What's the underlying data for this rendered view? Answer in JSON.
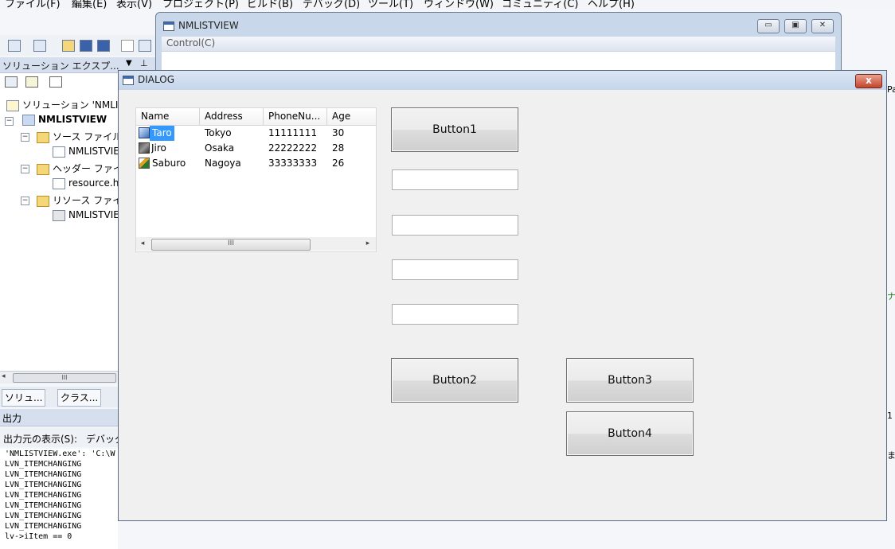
{
  "ide": {
    "menu": [
      "ファイル(F)",
      "編集(E)",
      "表示(V)",
      "プロジェクト(P)",
      "ビルド(B)",
      "デバッグ(D)",
      "ツール(T)",
      "ウィンドウ(W)",
      "コミュニティ(C)",
      "ヘルプ(H)"
    ],
    "solution_explorer_title": "ソリューション エクスプ...",
    "tree": {
      "solution": "ソリューション 'NMLI",
      "project": "NMLISTVIEW",
      "source_folder": "ソース ファイル",
      "source_file": "NMLISTVIE",
      "header_folder": "ヘッダー ファイ",
      "header_file": "resource.h",
      "resource_folder": "リソース ファイ",
      "resource_file": "NMLISTVIE"
    },
    "tabs": [
      "ソリュ...",
      "クラス..."
    ],
    "output_title": "出力",
    "output_source_label": "出力元の表示(S):",
    "output_source_value": "デバッグ",
    "output_lines": [
      "'NMLISTVIEW.exe': 'C:\\W",
      "LVN_ITEMCHANGING",
      "LVN_ITEMCHANGING",
      "LVN_ITEMCHANGING",
      "LVN_ITEMCHANGING",
      "LVN_ITEMCHANGING",
      "LVN_ITEMCHANGING",
      "LVN_ITEMCHANGING",
      "lv->iItem == 0"
    ],
    "right_edge_texts": [
      "Pa",
      "ナ",
      "1",
      "ま"
    ]
  },
  "nmlistview_window": {
    "title": "NMLISTVIEW",
    "menu_control": "Control(C)",
    "minimize": "▭",
    "maximize": "▣",
    "close": "✕"
  },
  "dialog": {
    "title": "DIALOG",
    "close": "x",
    "listview": {
      "columns": [
        "Name",
        "Address",
        "PhoneNu...",
        "Age"
      ],
      "rows": [
        {
          "name": "Taro",
          "address": "Tokyo",
          "phone": "11111111",
          "age": "30",
          "selected": true
        },
        {
          "name": "Jiro",
          "address": "Osaka",
          "phone": "22222222",
          "age": "28",
          "selected": false
        },
        {
          "name": "Saburo",
          "address": "Nagoya",
          "phone": "33333333",
          "age": "26",
          "selected": false
        }
      ],
      "scroll_left": "◂",
      "scroll_right": "▸",
      "scroll_grip": "III"
    },
    "buttons": {
      "button1": "Button1",
      "button2": "Button2",
      "button3": "Button3",
      "button4": "Button4"
    },
    "edits": [
      "",
      "",
      "",
      ""
    ]
  }
}
